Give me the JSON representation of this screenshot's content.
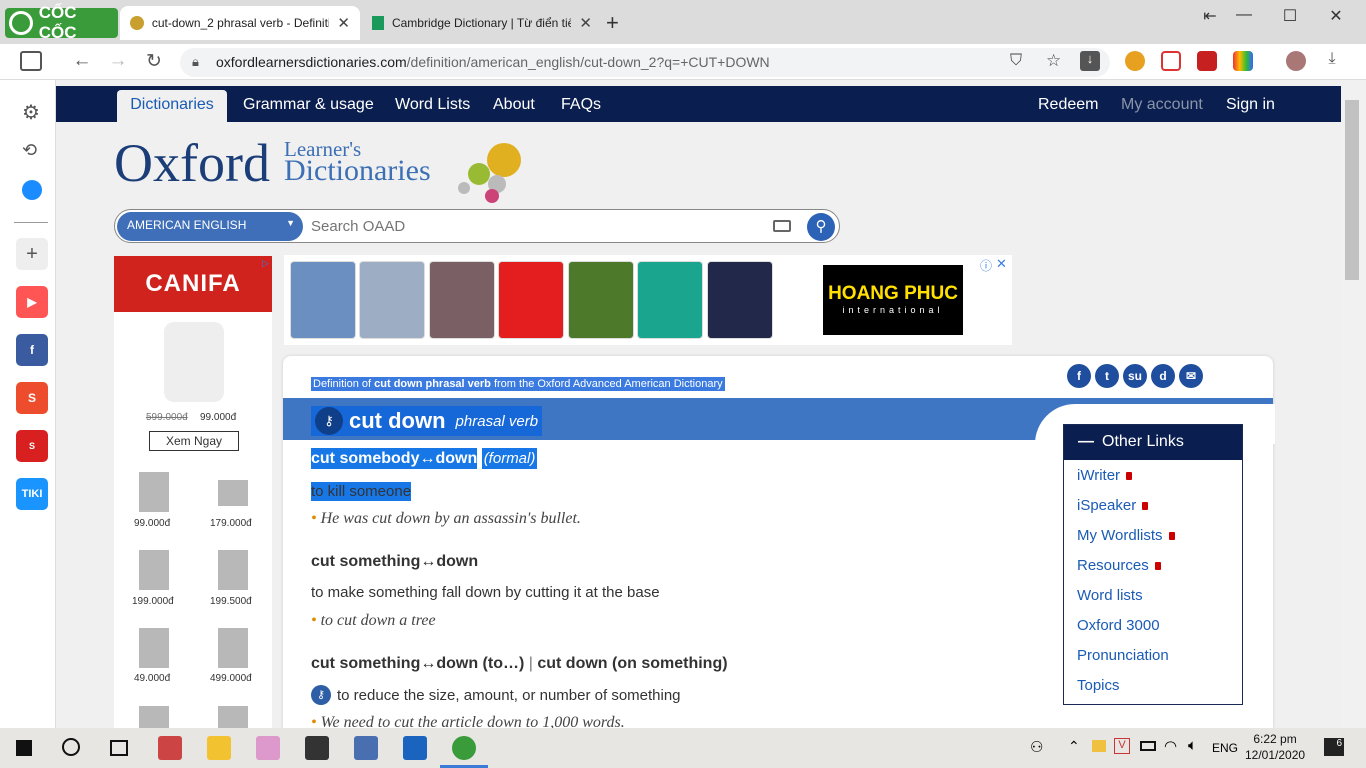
{
  "browser": {
    "brand": "CỐC CỐC",
    "tabs": [
      {
        "title": "cut-down_2 phrasal verb - Definitio"
      },
      {
        "title": "Cambridge Dictionary | Từ điển tiế"
      }
    ],
    "url_host": "oxfordlearnersdictionaries.com",
    "url_path": "/definition/american_english/cut-down_2?q=+CUT+DOWN"
  },
  "site": {
    "nav": [
      "Dictionaries",
      "Grammar & usage",
      "Word Lists",
      "About",
      "FAQs"
    ],
    "nav_right": [
      "Redeem",
      "My account",
      "Sign in"
    ],
    "logo_main": "Oxford",
    "logo_sub1": "Learner's",
    "logo_sub2": "Dictionaries",
    "search_lang": "AMERICAN ENGLISH",
    "search_placeholder": "Search OAAD"
  },
  "ads": {
    "left_brand": "CANIFA",
    "main_old_price": "599.000đ",
    "main_price": "99.000đ",
    "cta": "Xem Ngay",
    "prices": [
      "99.000đ",
      "179.000đ",
      "199.000đ",
      "199.500đ",
      "49.000đ",
      "499.000đ"
    ],
    "top_brand": "HOANG PHUC",
    "top_sub": "international"
  },
  "entry": {
    "def_of_prefix": "Definition of ",
    "def_of_word": "cut down phrasal verb",
    "def_of_suffix": " from the Oxford Advanced American Dictionary",
    "headword": "cut down",
    "pos": "phrasal verb",
    "senses": [
      {
        "phrase": "cut somebody↔down",
        "tag": "(formal)",
        "definition": "to kill someone",
        "example": "He was cut down by an assassin's bullet."
      },
      {
        "phrase": "cut something↔down",
        "definition": "to make something fall down by cutting it at the base",
        "example": "to cut down a tree"
      },
      {
        "phrase": "cut something↔down (to…)",
        "phrase2": "cut down (on something)",
        "definition": "to reduce the size, amount, or number of something",
        "example": "We need to cut the article down to 1,000 words."
      }
    ]
  },
  "other_links": {
    "title": "Other Links",
    "items": [
      "iWriter",
      "iSpeaker",
      "My Wordlists",
      "Resources",
      "Word lists",
      "Oxford 3000",
      "Pronunciation",
      "Topics"
    ]
  },
  "taskbar": {
    "lang": "ENG",
    "time": "6:22 pm",
    "date": "12/01/2020",
    "notifications": "6"
  }
}
